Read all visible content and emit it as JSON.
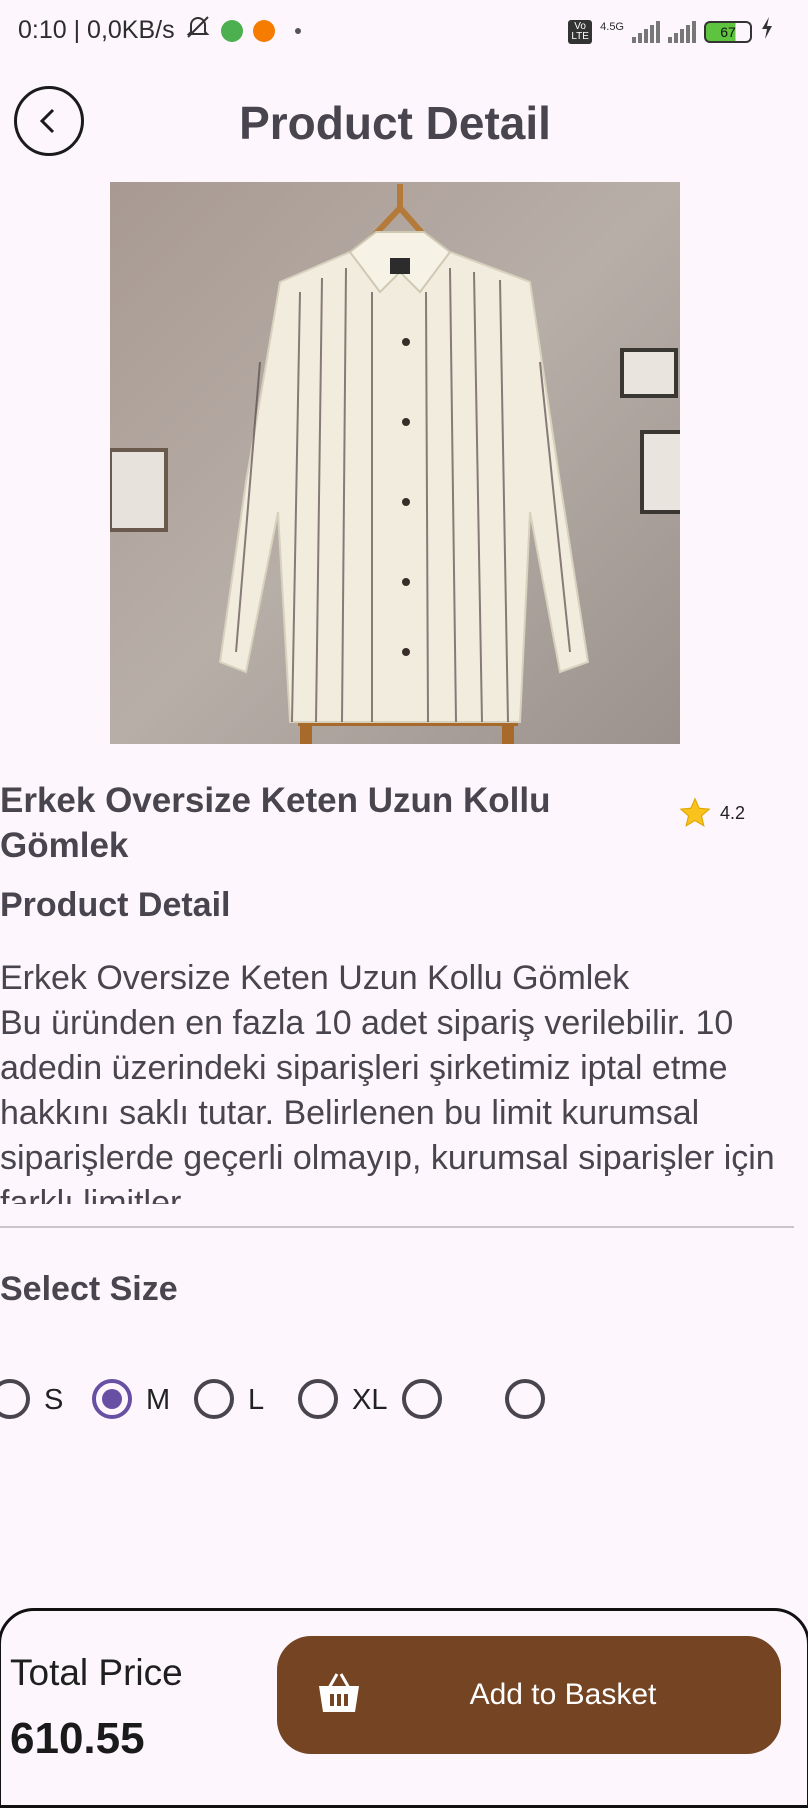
{
  "status_bar": {
    "time_speed": "0:10 | 0,0KB/s",
    "network_label": "4.5G",
    "volte_label": "Vo LTE",
    "battery_level": "67"
  },
  "header": {
    "title": "Product Detail"
  },
  "product": {
    "name": "Erkek Oversize Keten Uzun Kollu Gömlek",
    "rating": "4.2",
    "detail_heading": "Product Detail",
    "description": "Erkek Oversize Keten Uzun Kollu Gömlek\nBu üründen en fazla 10 adet sipariş verilebilir. 10 adedin üzerindeki siparişleri şirketimiz iptal etme hakkını saklı tutar. Belirlenen bu limit kurumsal siparişlerde geçerli olmayıp, kurumsal siparişler için farklı limitler"
  },
  "size_selector": {
    "heading": "Select Size",
    "options": [
      "S",
      "M",
      "L",
      "XL",
      "",
      ""
    ],
    "selected": "M"
  },
  "checkout": {
    "total_label": "Total Price",
    "total_value": "610.55",
    "button_label": "Add to Basket"
  },
  "colors": {
    "accent": "#6750a4",
    "button": "#744423",
    "background": "#fdf7fd"
  }
}
